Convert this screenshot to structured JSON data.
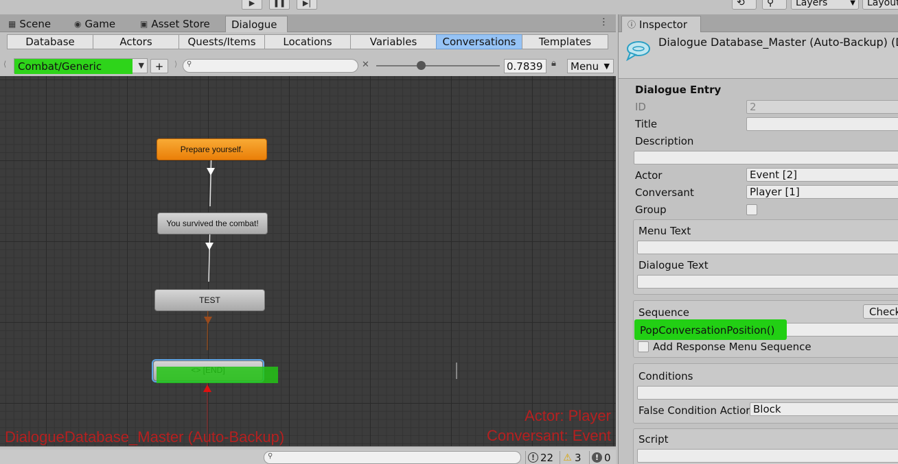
{
  "toolbar": {
    "layers_label": "Layers",
    "layout_label": "Layout"
  },
  "dialogue_window": {
    "tabs": [
      {
        "label": "Scene",
        "icon": "scene-icon"
      },
      {
        "label": "Game",
        "icon": "gamepad-icon"
      },
      {
        "label": "Asset Store",
        "icon": "store-bag-icon"
      },
      {
        "label": "Dialogue",
        "icon": ""
      }
    ],
    "active_tab": "Dialogue",
    "subtabs": [
      "Database",
      "Actors",
      "Quests/Items",
      "Locations",
      "Variables",
      "Conversations",
      "Templates"
    ],
    "active_subtab": "Conversations",
    "conversation_select": "Combat/Generic",
    "add_label": "+",
    "search_placeholder": "",
    "zoom_value": "0.7839",
    "menu_label": "Menu"
  },
  "canvas": {
    "nodes": [
      {
        "label": "Prepare yourself.",
        "style": "orange"
      },
      {
        "label": "You survived the combat!",
        "style": "gray"
      },
      {
        "label": "TEST",
        "style": "gray"
      },
      {
        "label": "<> [END]",
        "style": "gray-selected"
      }
    ],
    "overlay_database": "DialogueDatabase_Master (Auto-Backup)",
    "overlay_actor": "Actor: Player",
    "overlay_conversant": "Conversant: Event",
    "colors": {
      "overlay": "#b52020",
      "highlight": "#2ed41a",
      "orange_node": "#f29420"
    }
  },
  "status": {
    "info_count": "22",
    "warning_count": "3",
    "error_count": "0"
  },
  "inspector": {
    "tab_label": "Inspector",
    "title": "Dialogue Database_Master (Auto-Backup) (D",
    "section_title": "Dialogue Entry",
    "id_label": "ID",
    "id_value": "2",
    "title_label": "Title",
    "title_value": "",
    "description_label": "Description",
    "description_value": "",
    "actor_label": "Actor",
    "actor_value": "Event [2]",
    "conversant_label": "Conversant",
    "conversant_value": "Player [1]",
    "group_label": "Group",
    "menu_text_label": "Menu Text",
    "menu_text_value": "",
    "dialogue_text_label": "Dialogue Text",
    "dialogue_text_value": "",
    "sequence_label": "Sequence",
    "check_label": "Check",
    "sequence_value": "PopConversationPosition()",
    "add_response_label": "Add Response Menu Sequence",
    "conditions_label": "Conditions",
    "conditions_value": "",
    "false_condition_label": "False Condition Actior",
    "false_condition_value": "Block",
    "script_label": "Script",
    "script_value": ""
  }
}
